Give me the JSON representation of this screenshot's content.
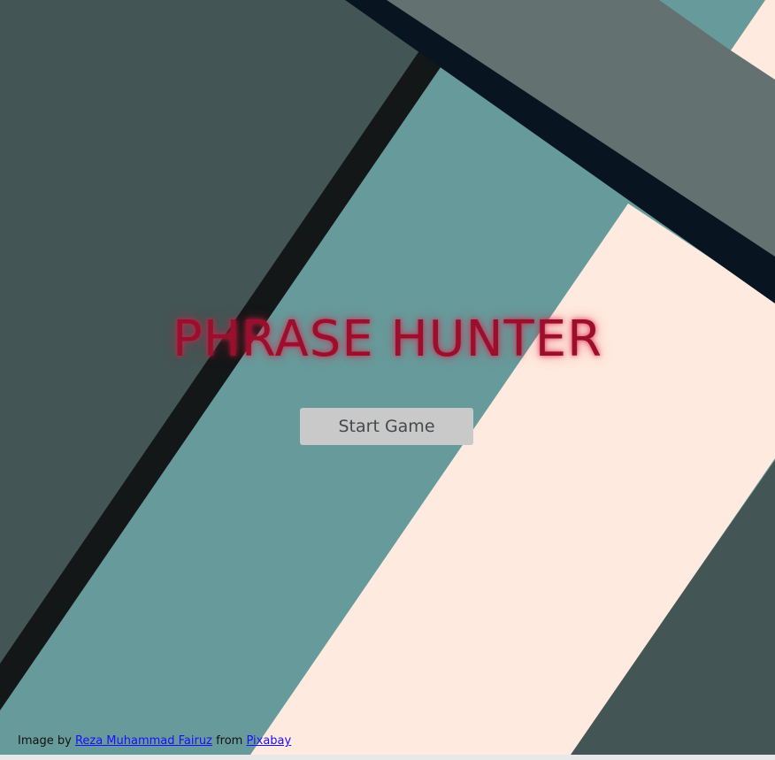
{
  "game": {
    "title": "PHRASE HUNTER",
    "start_button_label": "Start Game"
  },
  "credit": {
    "prefix": "Image by",
    "author": "Reza Muhammad Fairuz",
    "middle": "from",
    "source": "Pixabay"
  },
  "colors": {
    "title": "#9b0f2c",
    "button_bg": "#c9c9c9",
    "button_text": "#45494b",
    "link": "#1a0dff",
    "bg_dark_slate": "#435554",
    "bg_teal": "#679b9b",
    "bg_cream": "#ffeadf",
    "bg_grey": "#637271",
    "bg_navy_stripe": "#081520",
    "bg_black_stripe": "#131717"
  },
  "icons": {
    "background": "abstract-stripes-image"
  }
}
